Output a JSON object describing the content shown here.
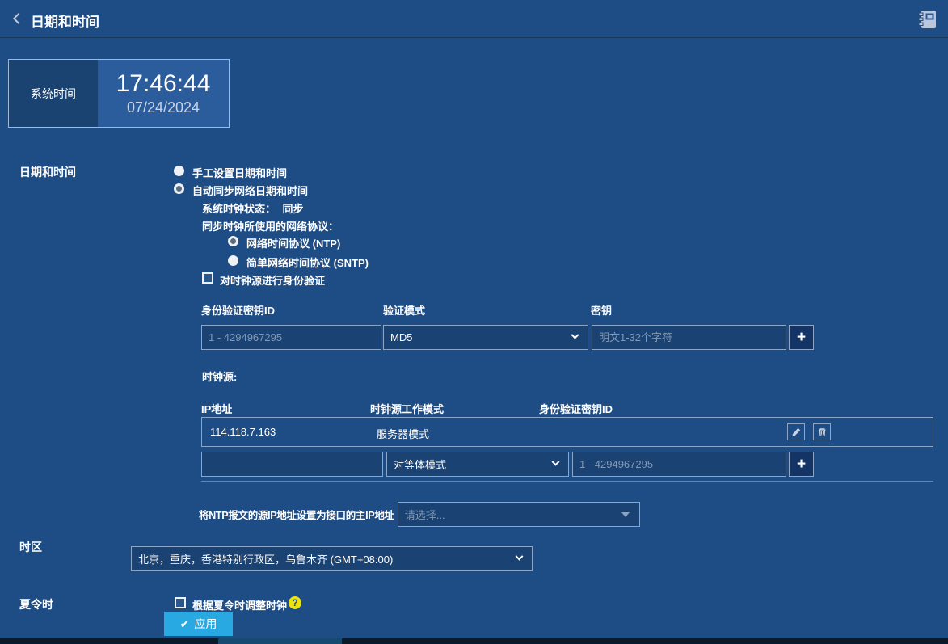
{
  "header": {
    "title": "日期和时间"
  },
  "system_time": {
    "label": "系统时间",
    "time": "17:46:44",
    "date": "07/24/2024"
  },
  "datetime": {
    "label": "日期和时间",
    "manual_option": "手工设置日期和时间",
    "auto_option": "自动同步网络日期和时间",
    "status_label": "系统时钟状态：",
    "status_value": "同步",
    "protocol_label": "同步时钟所使用的网络协议：",
    "ntp_option": "网络时间协议 (NTP)",
    "sntp_option": "简单网络时间协议 (SNTP)",
    "auth_option": "对时钟源进行身份验证"
  },
  "auth_key": {
    "col_key_id": "身份验证密钥ID",
    "col_mode": "验证模式",
    "col_key": "密钥",
    "key_id_placeholder": "1 - 4294967295",
    "mode_selected": "MD5",
    "key_placeholder": "明文1-32个字符",
    "add_label": "+"
  },
  "clock_source": {
    "label": "时钟源:",
    "col_ip": "IP地址",
    "col_mode": "时钟源工作模式",
    "col_key_id": "身份验证密钥ID",
    "row": {
      "ip": "114.118.7.163",
      "mode": "服务器模式"
    },
    "new_row": {
      "mode_selected": "对等体模式",
      "key_id_placeholder": "1 - 4294967295"
    },
    "add_label": "+"
  },
  "ntp_source": {
    "label": "将NTP报文的源IP地址设置为接口的主IP地址",
    "placeholder": "请选择..."
  },
  "timezone": {
    "label": "时区",
    "selected": "北京，重庆，香港特别行政区，乌鲁木齐 (GMT+08:00)"
  },
  "dst": {
    "label": "夏令时",
    "option": "根据夏令时调整时钟",
    "help_glyph": "?"
  },
  "apply_button": {
    "check_glyph": "✔",
    "label": "应用"
  },
  "colors": {
    "page_bg": "#1e4c85",
    "input_bg": "#1a4273",
    "input_border": "#8ba6c9",
    "placeholder_text": "#8199b8",
    "apply_blue": "#29a9e1",
    "help_yellow": "#ece30f",
    "time_card_left_bg": "#1a4372",
    "time_card_right_bg": "#2b5c9c",
    "scrollbar_track": "#0a1a2a",
    "scrollbar_thumb": "#174a70",
    "icon_light": "#c7d3e4"
  }
}
